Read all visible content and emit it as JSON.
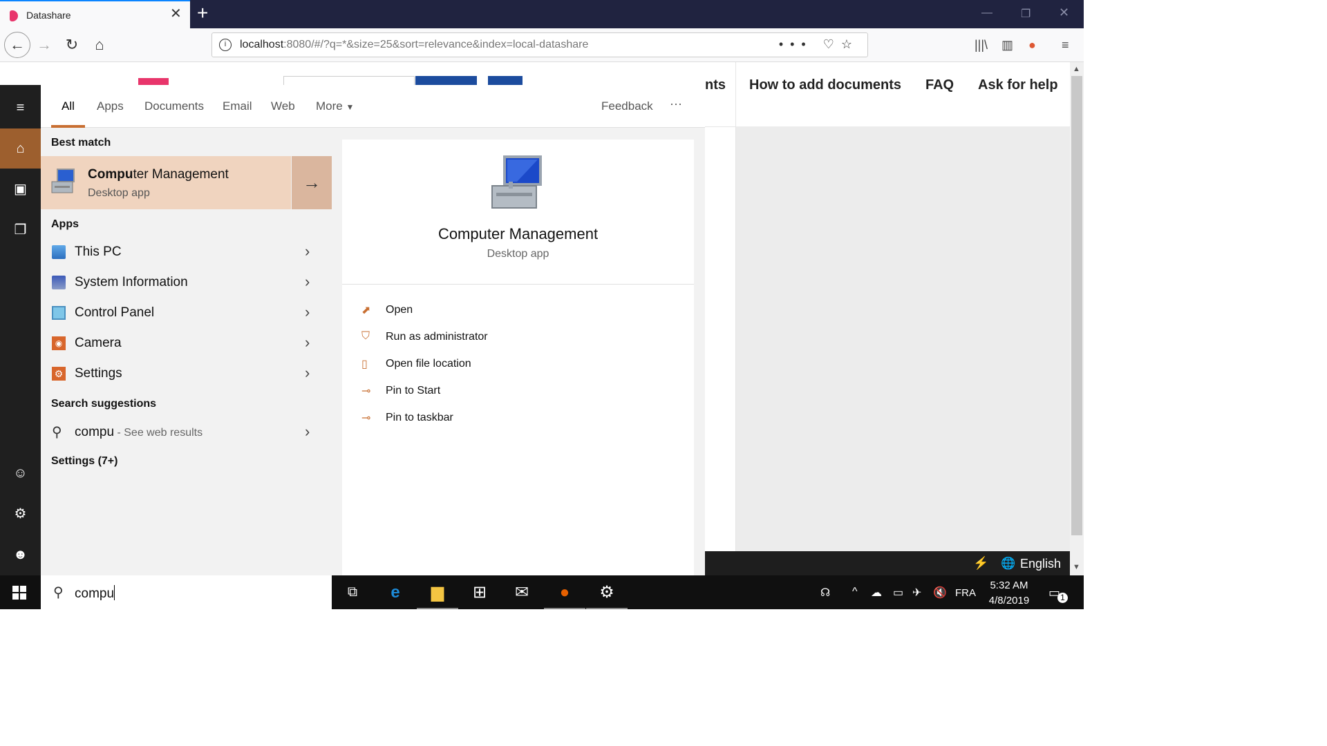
{
  "browser": {
    "tab_title": "Datashare",
    "url_host": "localhost",
    "url_rest": ":8080/#/?q=*&size=25&sort=relevance&index=local-datashare"
  },
  "page": {
    "nav": [
      "nts",
      "How to add documents",
      "FAQ",
      "Ask for help"
    ],
    "language_label": "English"
  },
  "search": {
    "filters": [
      "All",
      "Apps",
      "Documents",
      "Email",
      "Web",
      "More"
    ],
    "feedback_label": "Feedback",
    "more_options": "···",
    "best_match_heading": "Best match",
    "best_match": {
      "name_bold": "Compu",
      "name_rest": "ter Management",
      "subtitle": "Desktop app"
    },
    "apps_heading": "Apps",
    "apps": [
      {
        "label": "This PC",
        "icon": "computer-icon"
      },
      {
        "label": "System Information",
        "icon": "system-info-icon"
      },
      {
        "label": "Control Panel",
        "icon": "control-panel-icon"
      },
      {
        "label": "Camera",
        "icon": "camera-icon"
      },
      {
        "label": "Settings",
        "icon": "settings-icon"
      }
    ],
    "suggestions_heading": "Search suggestions",
    "suggestion": {
      "query": "compu",
      "suffix": " - See web results"
    },
    "settings_heading": "Settings (7+)",
    "query": "compu"
  },
  "preview": {
    "name": "Computer Management",
    "subtitle": "Desktop app",
    "actions": [
      "Open",
      "Run as administrator",
      "Open file location",
      "Pin to Start",
      "Pin to taskbar"
    ]
  },
  "taskbar": {
    "language": "FRA",
    "time": "5:32 AM",
    "date": "4/8/2019",
    "notification_count": "1"
  },
  "colors": {
    "accent": "#c86f32",
    "best_match_bg": "#f0d4bf"
  }
}
